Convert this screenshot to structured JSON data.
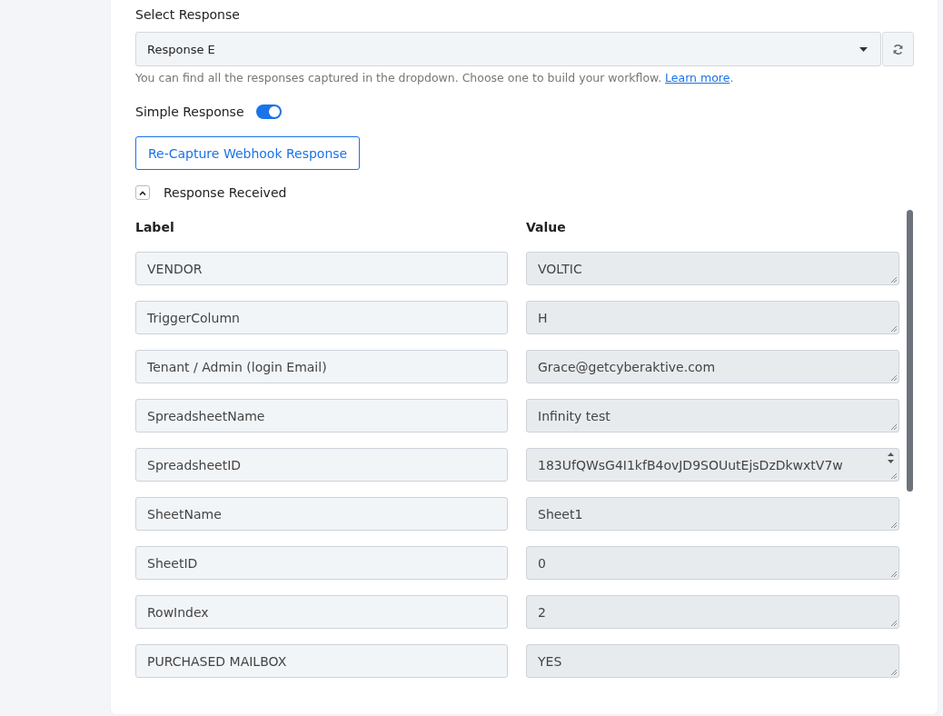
{
  "select_response": {
    "label": "Select Response",
    "value": "Response E",
    "help": "You can find all the responses captured in the dropdown. Choose one to build your workflow.",
    "help_link": "Learn more",
    "help_end": "."
  },
  "simple_response": {
    "label": "Simple Response",
    "on": true
  },
  "recapture_button": "Re-Capture Webhook Response",
  "response_received": {
    "title": "Response Received",
    "expanded": true,
    "columns": [
      "Label",
      "Value"
    ],
    "rows": [
      {
        "label": "VENDOR",
        "value": "VOLTIC"
      },
      {
        "label": "TriggerColumn",
        "value": "H"
      },
      {
        "label": "Tenant / Admin (login Email)",
        "value": "Grace@getcyberaktive.com"
      },
      {
        "label": "SpreadsheetName",
        "value": "Infinity test"
      },
      {
        "label": "SpreadsheetID",
        "value": "183UfQWsG4I1kfB4ovJD9SOUutEjsDzDkwxtV7w",
        "kind": "scroll"
      },
      {
        "label": "SheetName",
        "value": "Sheet1"
      },
      {
        "label": "SheetID",
        "value": "0"
      },
      {
        "label": "RowIndex",
        "value": "2"
      },
      {
        "label": "PURCHASED MAILBOX",
        "value": "YES"
      }
    ]
  }
}
